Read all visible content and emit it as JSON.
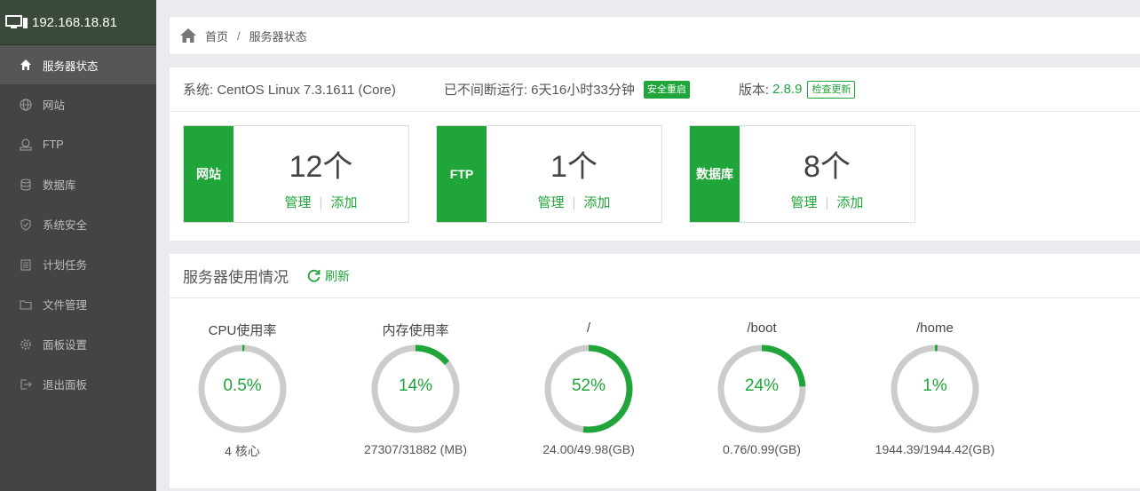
{
  "sidebar": {
    "ip": "192.168.18.81",
    "items": [
      {
        "label": "服务器状态",
        "icon": "home-icon",
        "active": true
      },
      {
        "label": "网站",
        "icon": "globe-icon"
      },
      {
        "label": "FTP",
        "icon": "ftp-icon"
      },
      {
        "label": "数据库",
        "icon": "database-icon"
      },
      {
        "label": "系统安全",
        "icon": "shield-icon"
      },
      {
        "label": "计划任务",
        "icon": "calendar-icon"
      },
      {
        "label": "文件管理",
        "icon": "folder-icon"
      },
      {
        "label": "面板设置",
        "icon": "gear-icon"
      },
      {
        "label": "退出面板",
        "icon": "logout-icon"
      }
    ]
  },
  "breadcrumb": {
    "home": "首页",
    "separator": "/",
    "current": "服务器状态"
  },
  "system": {
    "os_text": "系统: CentOS Linux 7.3.1611 (Core)",
    "uptime_text": "已不间断运行: 6天16小时33分钟",
    "restart_label": "安全重启",
    "version_label": "版本:",
    "version": "2.8.9",
    "update_label": "检查更新"
  },
  "cards": [
    {
      "tag": "网站",
      "count": "12个",
      "manage": "管理",
      "add": "添加"
    },
    {
      "tag": "FTP",
      "count": "1个",
      "manage": "管理",
      "add": "添加"
    },
    {
      "tag": "数据库",
      "count": "8个",
      "manage": "管理",
      "add": "添加"
    }
  ],
  "usage": {
    "title": "服务器使用情况",
    "refresh_label": "刷新",
    "gauges": [
      {
        "label": "CPU使用率",
        "percent_text": "0.5%",
        "fraction": 0.005,
        "sub": "4 核心"
      },
      {
        "label": "内存使用率",
        "percent_text": "14%",
        "fraction": 0.14,
        "sub": "27307/31882 (MB)"
      },
      {
        "label": "/",
        "percent_text": "52%",
        "fraction": 0.52,
        "sub": "24.00/49.98(GB)"
      },
      {
        "label": "/boot",
        "percent_text": "24%",
        "fraction": 0.24,
        "sub": "0.76/0.99(GB)"
      },
      {
        "label": "/home",
        "percent_text": "1%",
        "fraction": 0.01,
        "sub": "1944.39/1944.42(GB)"
      }
    ]
  },
  "colors": {
    "accent": "#20a53a",
    "track": "#cccccc",
    "sidebar": "#444444"
  }
}
